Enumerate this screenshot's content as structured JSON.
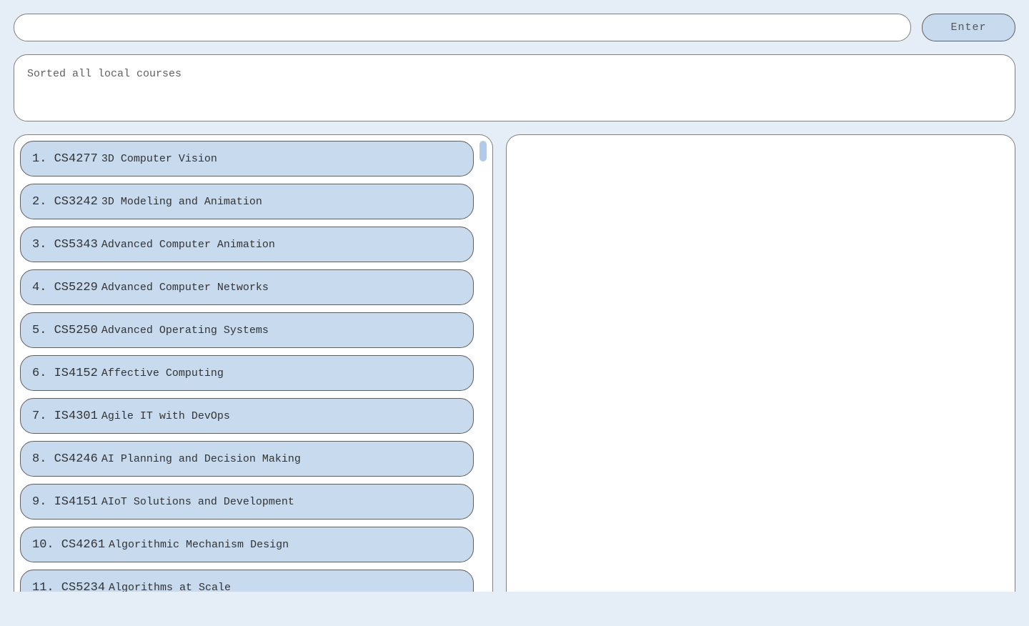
{
  "search": {
    "value": ""
  },
  "enter_button": "Enter",
  "status": {
    "text": "Sorted all local courses"
  },
  "courses": [
    {
      "index": "1",
      "code": "CS4277",
      "title": "3D Computer Vision"
    },
    {
      "index": "2",
      "code": "CS3242",
      "title": "3D Modeling and Animation"
    },
    {
      "index": "3",
      "code": "CS5343",
      "title": "Advanced Computer Animation"
    },
    {
      "index": "4",
      "code": "CS5229",
      "title": "Advanced Computer Networks"
    },
    {
      "index": "5",
      "code": "CS5250",
      "title": "Advanced Operating Systems"
    },
    {
      "index": "6",
      "code": "IS4152",
      "title": "Affective Computing"
    },
    {
      "index": "7",
      "code": "IS4301",
      "title": "Agile IT with DevOps"
    },
    {
      "index": "8",
      "code": "CS4246",
      "title": "AI Planning and Decision Making"
    },
    {
      "index": "9",
      "code": "IS4151",
      "title": "AIoT Solutions and Development"
    },
    {
      "index": "10",
      "code": "CS4261",
      "title": "Algorithmic Mechanism Design"
    },
    {
      "index": "11",
      "code": "CS5234",
      "title": "Algorithms at Scale"
    }
  ]
}
